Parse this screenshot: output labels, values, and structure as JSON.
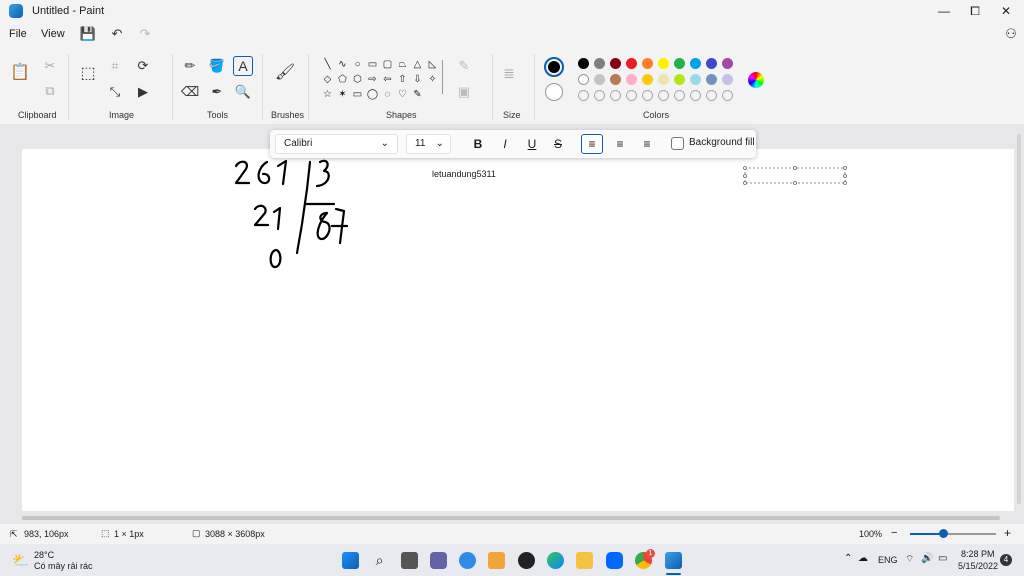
{
  "window": {
    "title": "Untitled - Paint",
    "minimize": "—",
    "maximize": "⧠",
    "close": "✕"
  },
  "menu": {
    "file": "File",
    "view": "View"
  },
  "ribbon": {
    "clipboard": "Clipboard",
    "image": "Image",
    "tools": "Tools",
    "brushes": "Brushes",
    "shapes": "Shapes",
    "size": "Size",
    "colors": "Colors"
  },
  "shapes": [
    "╲",
    "∿",
    "○",
    "▭",
    "▢",
    "⏢",
    "△",
    "◺",
    "◇",
    "⬠",
    "⬡",
    "⇨",
    "⇦",
    "⇧",
    "⇩",
    "✧",
    "☆",
    "✶",
    "▭",
    "◯",
    "◌",
    "♡",
    "✎"
  ],
  "palette": {
    "row1": [
      "#000000",
      "#7f7f7f",
      "#880015",
      "#ed1c24",
      "#ff7f27",
      "#fff200",
      "#22b14c",
      "#00a2e8",
      "#3f48cc",
      "#a349a4"
    ],
    "row2": [
      "#ffffff",
      "#c3c3c3",
      "#b97a57",
      "#ffaec9",
      "#ffc90e",
      "#efe4b0",
      "#b5e61d",
      "#99d9ea",
      "#7092be",
      "#c8bfe7"
    ],
    "primary": "#000000",
    "secondary": "#ffffff"
  },
  "text_toolbar": {
    "font": "Calibri",
    "size": "11",
    "bold": "B",
    "italic": "I",
    "underline": "U",
    "strike": "S",
    "background_fill": "Background fill"
  },
  "canvas": {
    "text": "letuandung5311"
  },
  "status": {
    "cursor": "983, 106px",
    "selection": "1 × 1px",
    "canvas_size": "3088 × 3608px",
    "zoom": "100%"
  },
  "taskbar": {
    "temp": "28°C",
    "weather": "Có mây rải rác",
    "lang": "ENG",
    "time": "8:28 PM",
    "date": "5/15/2022",
    "badge": "1",
    "notif": "4"
  }
}
